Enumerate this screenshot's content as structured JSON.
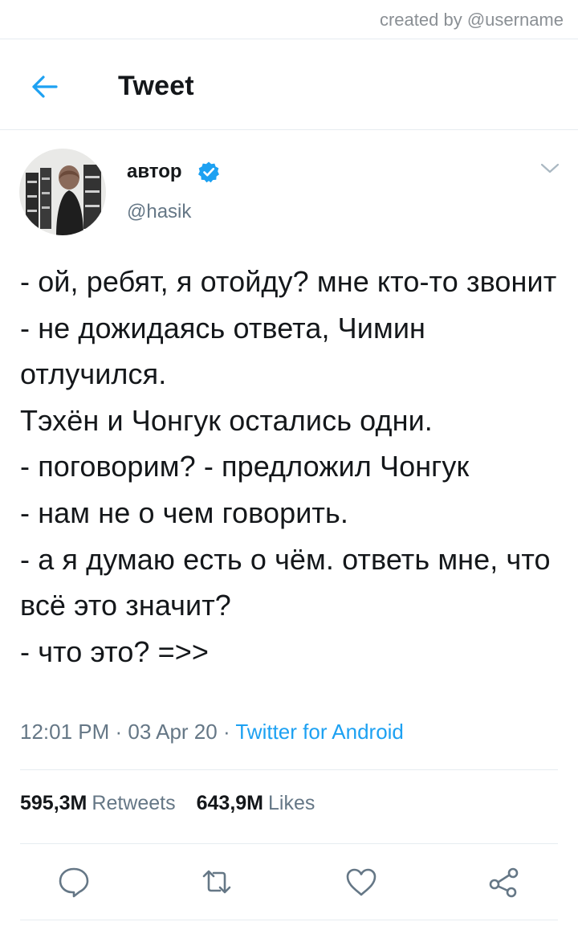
{
  "credit": "created by @username",
  "header": {
    "title": "Tweet"
  },
  "author": {
    "name": "автор",
    "handle": "@hasik"
  },
  "tweet": {
    "text": "- ой, ребят, я отойду? мне кто-то звонит - не дожидаясь ответа, Чимин отлучился.\nТэхён и Чонгук остались одни.\n- поговорим? - предложил Чонгук\n- нам не о чем говорить.\n- а я думаю есть о чём. ответь мне, что всё это значит?\n- что это? =>>",
    "time": "12:01 PM",
    "date": "03 Apr 20",
    "source": "Twitter for Android",
    "separator": " · "
  },
  "stats": {
    "retweets_count": "595,3M",
    "retweets_label": "Retweets",
    "likes_count": "643,9M",
    "likes_label": "Likes"
  },
  "icons": {
    "back": "arrow-left-icon",
    "verified": "verified-badge-icon",
    "menu": "chevron-down-icon",
    "reply": "reply-bubble-icon",
    "retweet": "retweet-icon",
    "like": "heart-icon",
    "share": "share-icon"
  },
  "colors": {
    "accent": "#1da1f2",
    "text": "#14171a",
    "secondary": "#657786",
    "divider": "#e6ecf0"
  }
}
